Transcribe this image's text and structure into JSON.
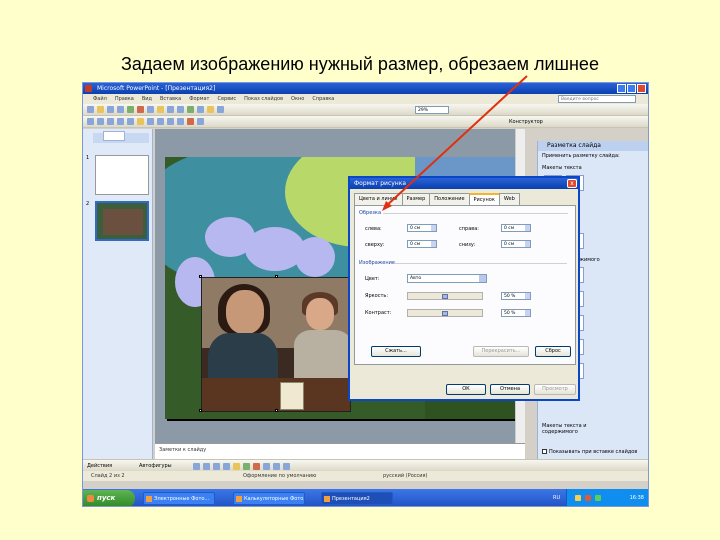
{
  "caption": "Задаем изображению нужный размер, обрезаем лишнее",
  "window": {
    "title": "Microsoft PowerPoint - [Презентация2]",
    "help_placeholder": "Введите вопрос"
  },
  "menu": [
    "Файл",
    "Правка",
    "Вид",
    "Вставка",
    "Формат",
    "Сервис",
    "Показ слайдов",
    "Окно",
    "Справка"
  ],
  "toolbar": {
    "zoom": "29%",
    "design_label": "Конструктор"
  },
  "outline": {
    "slide_numbers": [
      "1",
      "2"
    ]
  },
  "notes": {
    "placeholder": "Заметки к слайду"
  },
  "task_pane": {
    "title": "Разметка слайда",
    "subtitle": "Применить разметку слайда:",
    "section_text_layouts": "Макеты текста",
    "section_content_layouts": "Макеты содержимого",
    "section_text_content_layouts": "Макеты текста и содержимого",
    "show_on_insert": "Показывать при вставке слайдов"
  },
  "drawing_toolbar": {
    "draw": "Действия",
    "autoshapes": "Автофигуры"
  },
  "status_bar": {
    "slide": "Слайд 2 из 2",
    "design": "Оформление по умолчанию",
    "language": "русский (Россия)"
  },
  "taskbar": {
    "start": "пуск",
    "tasks": [
      "Электронные Фото...",
      "Калькуляторные Фото...",
      "Презентация2"
    ],
    "lang": "RU",
    "time": "16:38"
  },
  "dialog": {
    "title": "Формат рисунка",
    "close": "x",
    "tabs": [
      "Цвета и линии",
      "Размер",
      "Положение",
      "Рисунок",
      "Web"
    ],
    "active_tab": 3,
    "crop": {
      "group": "Обрезка",
      "left_label": "слева:",
      "left_value": "0 см",
      "top_label": "сверху:",
      "top_value": "0 см",
      "right_label": "справа:",
      "right_value": "0 см",
      "bottom_label": "снизу:",
      "bottom_value": "0 см"
    },
    "image": {
      "group": "Изображение",
      "color_label": "Цвет:",
      "color_value": "Авто",
      "brightness_label": "Яркость:",
      "brightness_value": "50 %",
      "contrast_label": "Контраст:",
      "contrast_value": "50 %"
    },
    "buttons": {
      "compress": "Сжать...",
      "recolor": "Перекрасить...",
      "reset": "Сброс",
      "ok": "ОК",
      "cancel": "Отмена",
      "preview": "Просмотр"
    }
  },
  "colors": {
    "arrow": "#e03010",
    "title_blue": "#0a46c8",
    "background": "#ffffcc"
  }
}
